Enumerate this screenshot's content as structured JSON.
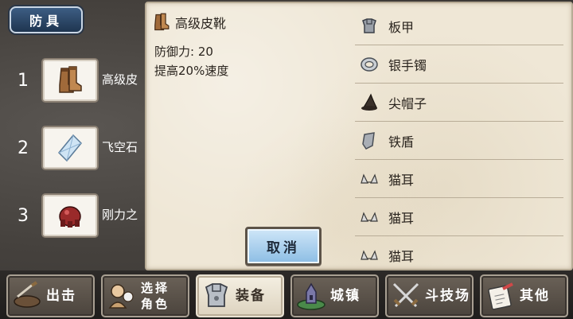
{
  "category_tab": {
    "label": "防具"
  },
  "slots": [
    {
      "number": "1",
      "name": "高级皮",
      "icon": "boots-icon"
    },
    {
      "number": "2",
      "name": "飞空石",
      "icon": "crystal-icon"
    },
    {
      "number": "3",
      "name": "刚力之",
      "icon": "gauntlet-icon"
    }
  ],
  "detail": {
    "title": "高级皮靴",
    "icon": "boots-icon",
    "defense": "防御力: 20",
    "effect": "提高20%速度"
  },
  "cancel_button": {
    "label": "取消"
  },
  "item_list": [
    {
      "label": "板甲",
      "icon": "plate-armor-icon"
    },
    {
      "label": "银手镯",
      "icon": "bracelet-icon"
    },
    {
      "label": "尖帽子",
      "icon": "pointed-hat-icon"
    },
    {
      "label": "铁盾",
      "icon": "shield-icon"
    },
    {
      "label": "猫耳",
      "icon": "cat-ears-icon"
    },
    {
      "label": "猫耳",
      "icon": "cat-ears-icon"
    },
    {
      "label": "猫耳",
      "icon": "cat-ears-icon"
    }
  ],
  "nav": [
    {
      "label": "出击",
      "icon": "sortie-icon",
      "active": false
    },
    {
      "label": "选择\n角色",
      "icon": "characters-icon",
      "active": false
    },
    {
      "label": "装备",
      "icon": "armor-icon",
      "active": true
    },
    {
      "label": "城镇",
      "icon": "town-icon",
      "active": false
    },
    {
      "label": "斗技场",
      "icon": "swords-icon",
      "active": false
    },
    {
      "label": "其他",
      "icon": "notes-icon",
      "active": false
    }
  ]
}
